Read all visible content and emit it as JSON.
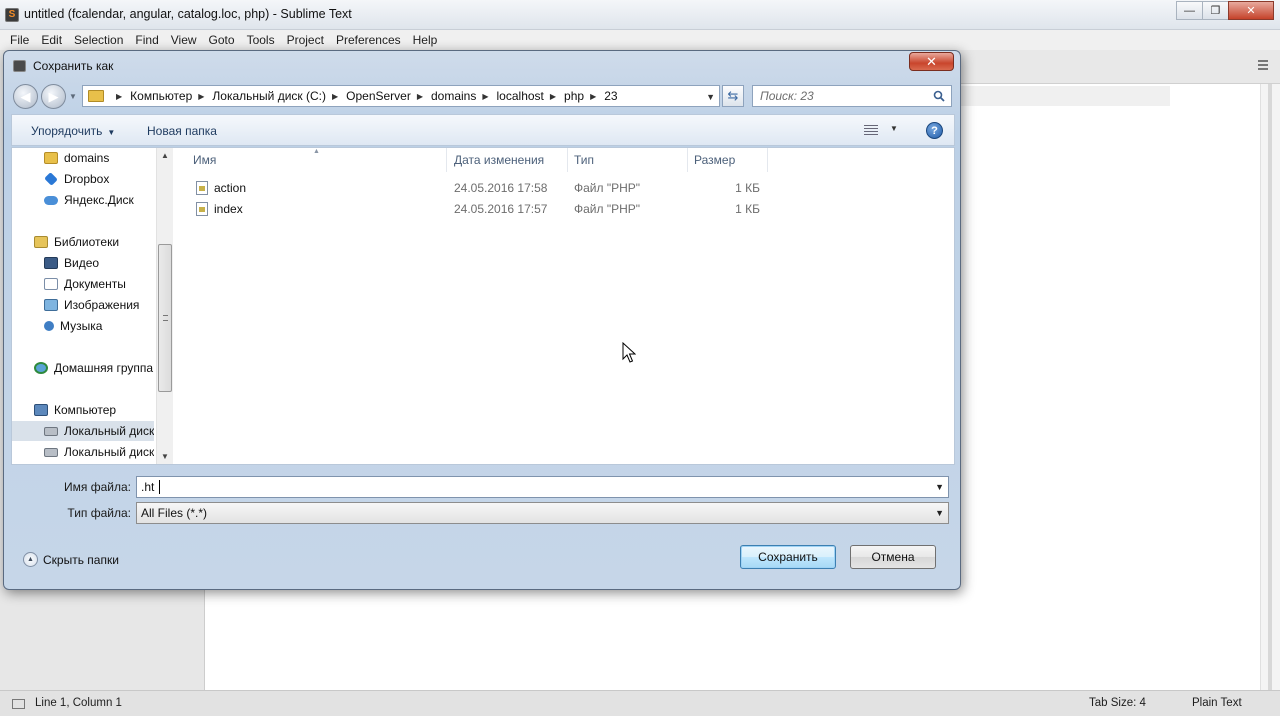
{
  "window": {
    "title": "untitled (fcalendar, angular, catalog.loc, php) - Sublime Text",
    "controls": {
      "minimize": "—",
      "maximize": "❐",
      "close": "✕"
    }
  },
  "menu": [
    "File",
    "Edit",
    "Selection",
    "Find",
    "View",
    "Goto",
    "Tools",
    "Project",
    "Preferences",
    "Help"
  ],
  "statusbar": {
    "position": "Line 1, Column 1",
    "tab_size": "Tab Size: 4",
    "syntax": "Plain Text"
  },
  "dialog": {
    "title": "Сохранить как",
    "close": "✕",
    "breadcrumb": [
      "Компьютер",
      "Локальный диск (C:)",
      "OpenServer",
      "domains",
      "localhost",
      "php",
      "23"
    ],
    "search_placeholder": "Поиск: 23",
    "toolbar": {
      "organize": "Упорядочить",
      "new_folder": "Новая папка",
      "help": "?"
    },
    "nav_tree": [
      {
        "label": "domains",
        "icon": "folder-icon"
      },
      {
        "label": "Dropbox",
        "icon": "dropbox-icon"
      },
      {
        "label": "Яндекс.Диск",
        "icon": "cloud-icon"
      },
      {
        "label": "Библиотеки",
        "icon": "libraries-icon"
      },
      {
        "label": "Видео",
        "icon": "video-icon"
      },
      {
        "label": "Документы",
        "icon": "documents-icon"
      },
      {
        "label": "Изображения",
        "icon": "pictures-icon"
      },
      {
        "label": "Музыка",
        "icon": "music-icon"
      },
      {
        "label": "Домашняя группа",
        "icon": "homegroup-icon"
      },
      {
        "label": "Компьютер",
        "icon": "computer-icon"
      },
      {
        "label": "Локальный диск",
        "icon": "disk-icon"
      },
      {
        "label": "Локальный диск",
        "icon": "disk-icon"
      }
    ],
    "columns": [
      "Имя",
      "Дата изменения",
      "Тип",
      "Размер"
    ],
    "files": [
      {
        "name": "action",
        "date": "24.05.2016 17:58",
        "type": "Файл \"PHP\"",
        "size": "1 КБ"
      },
      {
        "name": "index",
        "date": "24.05.2016 17:57",
        "type": "Файл \"PHP\"",
        "size": "1 КБ"
      }
    ],
    "filename_label": "Имя файла:",
    "filename_value": ".ht",
    "filetype_label": "Тип файла:",
    "filetype_value": "All Files (*.*)",
    "hide_folders": "Скрыть папки",
    "save": "Сохранить",
    "cancel": "Отмена"
  }
}
